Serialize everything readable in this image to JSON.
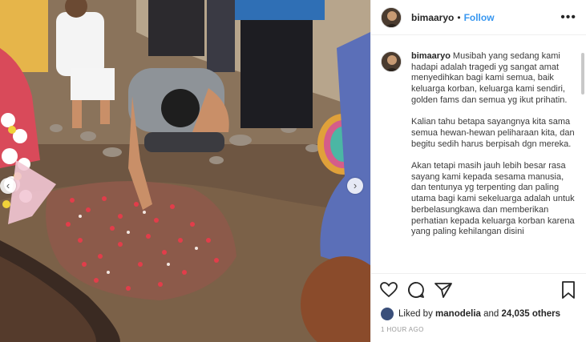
{
  "post": {
    "username": "bimaaryo",
    "follow_label": "Follow",
    "separator": "•",
    "caption": {
      "paragraph_1": "Musibah yang sedang kami hadapi adalah tragedi yg sangat amat menyedihkan bagi kami semua, baik keluarga korban, keluarga kami sendiri, golden fams dan semua yg ikut prihatin.",
      "paragraph_2": "Kalian tahu betapa sayangnya kita sama semua hewan-hewan peliharaan kita, dan begitu sedih harus berpisah dgn mereka.",
      "paragraph_3": "Akan tetapi masih jauh lebih besar rasa sayang kami kepada sesama manusia, dan tentunya yg terpenting dan paling utama bagi kami sekeluarga adalah untuk berbelasungkawa dan memberikan perhatian kepada keluarga korban karena yang paling kehilangan disini"
    },
    "likes": {
      "prefix": "Liked by",
      "user": "manodelia",
      "conjunction": "and",
      "count": "24,035 others"
    },
    "timestamp": "1 HOUR AGO"
  },
  "icons": {
    "more": "more-options-icon",
    "like": "heart-icon",
    "comment": "comment-icon",
    "share": "share-icon",
    "save": "bookmark-icon",
    "prev": "chevron-left-icon",
    "next": "chevron-right-icon"
  },
  "colors": {
    "follow": "#3897f0",
    "text": "#262626",
    "meta": "#999999"
  }
}
